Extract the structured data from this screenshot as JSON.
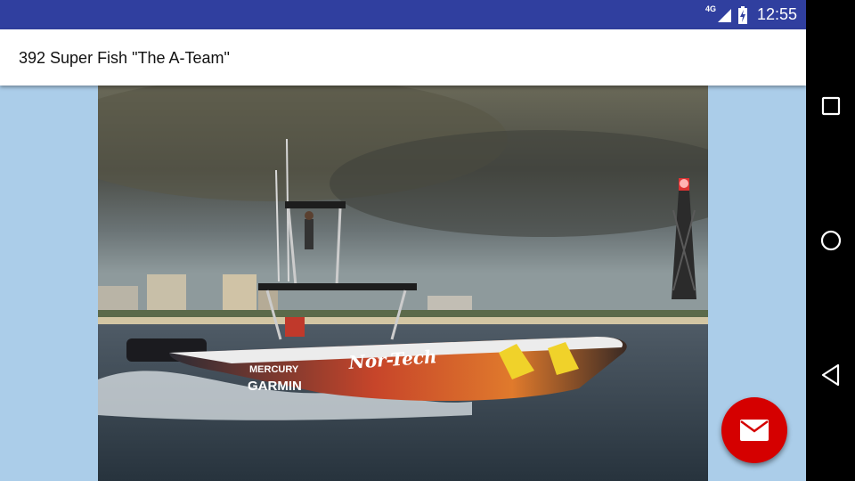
{
  "status_bar": {
    "network": "4G",
    "time": "12:55",
    "icons": [
      "signal-icon",
      "battery-charging-icon"
    ]
  },
  "app_bar": {
    "title": "392 Super Fish \"The A-Team\""
  },
  "photo": {
    "hull_text": {
      "brand1": "MERCURY",
      "brand2": "GARMIN",
      "script": "Nor-Tech"
    }
  },
  "fab": {
    "icon": "mail-icon"
  },
  "nav_bar": {
    "buttons": [
      "recents-icon",
      "home-icon",
      "back-icon"
    ]
  },
  "colors": {
    "status_bar": "#303f9f",
    "app_bar": "#ffffff",
    "background": "#abcde9",
    "fab": "#d50000"
  }
}
